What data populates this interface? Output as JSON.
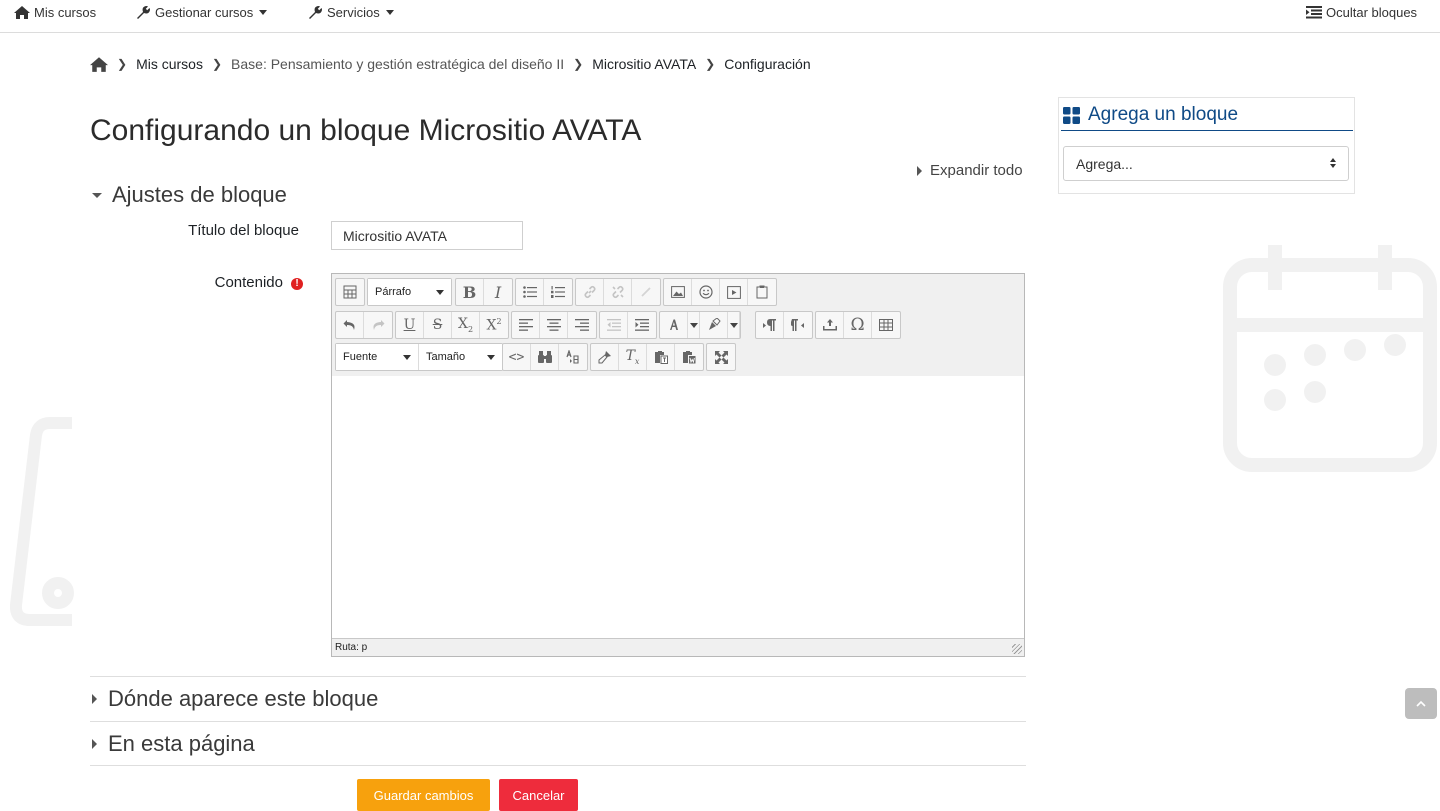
{
  "navbar": {
    "my_courses": "Mis cursos",
    "manage_courses": "Gestionar cursos",
    "services": "Servicios",
    "hide_blocks": "Ocultar bloques"
  },
  "breadcrumb": {
    "items": [
      "Mis cursos",
      "Base: Pensamiento y gestión estratégica del diseño II",
      "Micrositio AVATA",
      "Configuración"
    ]
  },
  "page": {
    "title": "Configurando un bloque Micrositio AVATA",
    "expand_all": "Expandir todo"
  },
  "sections": {
    "block_settings": "Ajustes de bloque",
    "where_appears": "Dónde aparece este bloque",
    "on_this_page": "En esta página"
  },
  "form": {
    "title_label": "Título del bloque",
    "title_value": "Micrositio AVATA",
    "content_label": "Contenido"
  },
  "editor": {
    "format_select": "Párrafo",
    "font_select": "Fuente",
    "size_select": "Tamaño",
    "status_path": "Ruta: p"
  },
  "buttons": {
    "save": "Guardar cambios",
    "cancel": "Cancelar"
  },
  "block_panel": {
    "heading": "Agrega un bloque",
    "select_value": "Agrega..."
  },
  "colors": {
    "save_button": "#f7a10d",
    "cancel_button": "#ee2c3c",
    "block_heading": "#0f4a86",
    "required_icon": "#e02020"
  }
}
